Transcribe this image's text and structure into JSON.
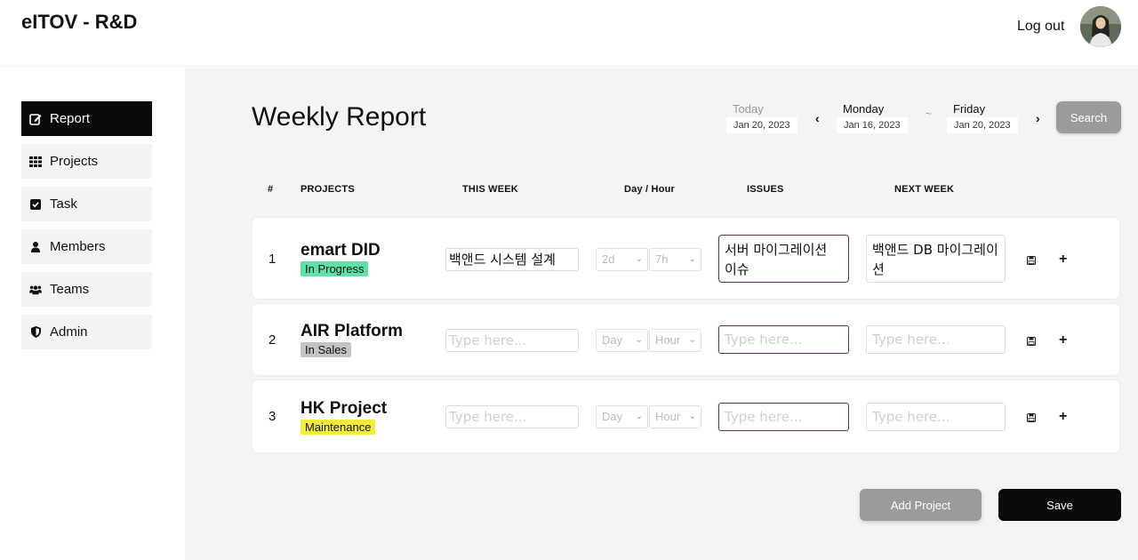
{
  "app": {
    "brand": "eITOV - R&D",
    "logout_label": "Log out"
  },
  "sidebar": {
    "items": [
      {
        "label": "Report",
        "icon": "edit-icon",
        "active": true
      },
      {
        "label": "Projects",
        "icon": "grid-icon"
      },
      {
        "label": "Task",
        "icon": "checkbox-icon"
      },
      {
        "label": "Members",
        "icon": "user-icon"
      },
      {
        "label": "Teams",
        "icon": "users-icon"
      },
      {
        "label": "Admin",
        "icon": "shield-icon"
      }
    ]
  },
  "header": {
    "title": "Weekly Report",
    "today_label": "Today",
    "today_date": "Jan 20, 2023",
    "start_label": "Monday",
    "start_date": "Jan 16, 2023",
    "separator": "~",
    "end_label": "Friday",
    "end_date": "Jan 20, 2023",
    "search_label": "Search"
  },
  "table": {
    "columns": [
      "#",
      "PROJECTS",
      "THIS WEEK",
      "Day / Hour",
      "ISSUES",
      "NEXT WEEK"
    ],
    "placeholder": "Type here...",
    "day_placeholder": "Day",
    "hour_placeholder": "Hour",
    "rows": [
      {
        "num": "1",
        "name": "emart DID",
        "status": "In Progress",
        "status_color": "#5fe0a6",
        "this_week": "백앤드 시스템 설계",
        "day": "2d",
        "hour": "7h",
        "issues": "서버 마이그레이션 이슈",
        "next_week": "백앤드 DB 마이그레이션"
      },
      {
        "num": "2",
        "name": "AIR Platform",
        "status": "In Sales",
        "status_color": "#c4c4c4",
        "this_week": "",
        "day": "",
        "hour": "",
        "issues": "",
        "next_week": ""
      },
      {
        "num": "3",
        "name": "HK Project",
        "status": "Maintenance",
        "status_color": "#f5ec3a",
        "this_week": "",
        "day": "",
        "hour": "",
        "issues": "",
        "next_week": ""
      }
    ]
  },
  "footer": {
    "add_label": "Add Project",
    "save_label": "Save"
  }
}
